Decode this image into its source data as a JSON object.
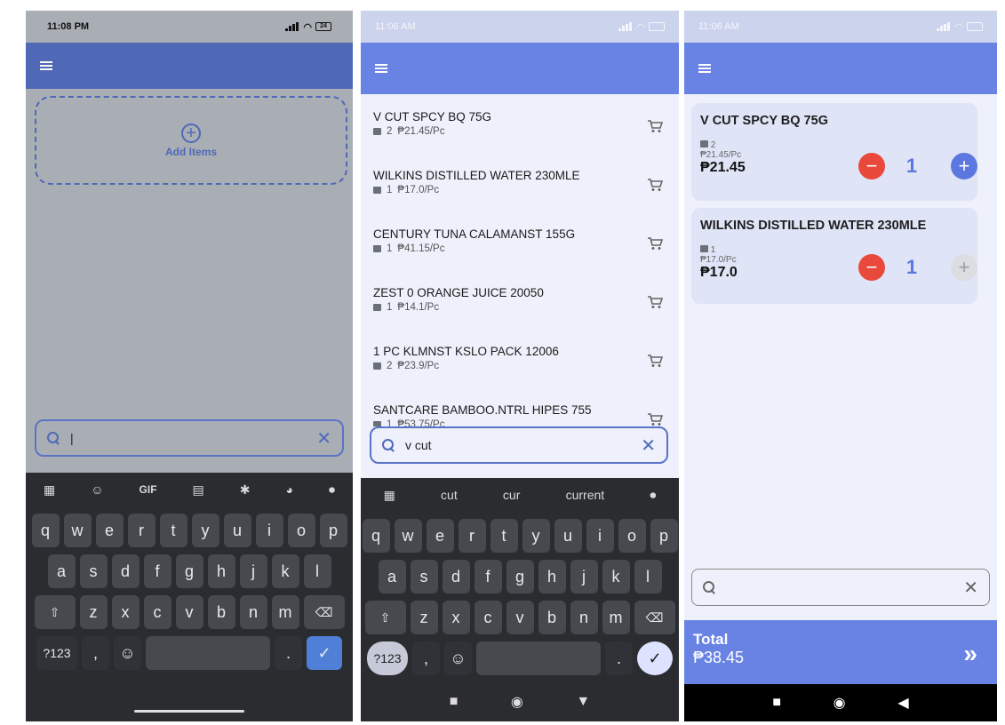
{
  "p1": {
    "status_time": "11:08 PM",
    "status_batt": "24",
    "add_label": "Add Items",
    "search_value": "|",
    "kb_top": [
      "GIF"
    ],
    "row1": [
      "q",
      "w",
      "e",
      "r",
      "t",
      "y",
      "u",
      "i",
      "o",
      "p"
    ],
    "row2": [
      "a",
      "s",
      "d",
      "f",
      "g",
      "h",
      "j",
      "k",
      "l"
    ],
    "row3": [
      "z",
      "x",
      "c",
      "v",
      "b",
      "n",
      "m"
    ],
    "row4_left": "?123",
    "row4_comma": ","
  },
  "p2": {
    "status_time": "11:06 AM",
    "items": [
      {
        "name": "V CUT SPCY BQ 75G",
        "qty": "2",
        "price": "₱21.45/Pc"
      },
      {
        "name": "WILKINS DISTILLED WATER 230MLE",
        "qty": "1",
        "price": "₱17.0/Pc"
      },
      {
        "name": "CENTURY TUNA CALAMANST 155G",
        "qty": "1",
        "price": "₱41.15/Pc"
      },
      {
        "name": "ZEST 0 ORANGE JUICE 20050",
        "qty": "1",
        "price": "₱14.1/Pc"
      },
      {
        "name": "1 PC KLMNST KSLO PACK 12006",
        "qty": "2",
        "price": "₱23.9/Pc"
      },
      {
        "name": "SANTCARE BAMBOO.NTRL HIPES 755",
        "qty": "1",
        "price": "₱53.75/Pc"
      }
    ],
    "search_value": "v cut",
    "suggestions": [
      "cut",
      "cur",
      "current"
    ],
    "row1": [
      "q",
      "w",
      "e",
      "r",
      "t",
      "y",
      "u",
      "i",
      "o",
      "p"
    ],
    "row2": [
      "a",
      "s",
      "d",
      "f",
      "g",
      "h",
      "j",
      "k",
      "l"
    ],
    "row3": [
      "z",
      "x",
      "c",
      "v",
      "b",
      "n",
      "m"
    ],
    "row4_left": "?123",
    "row4_comma": ","
  },
  "p3": {
    "status_time": "11:06 AM",
    "cards": [
      {
        "name": "V CUT SPCY BQ 75G",
        "qty_box": "2",
        "unit": "₱21.45/Pc",
        "total": "₱21.45",
        "count": "1"
      },
      {
        "name": "WILKINS DISTILLED WATER 230MLE",
        "qty_box": "1",
        "unit": "₱17.0/Pc",
        "total": "₱17.0",
        "count": "1"
      }
    ],
    "search_value": "",
    "total_label": "Total",
    "total_value": "₱38.45",
    "next": "»"
  },
  "colors": {
    "primary": "#6883e3",
    "minus": "#e8493a"
  }
}
